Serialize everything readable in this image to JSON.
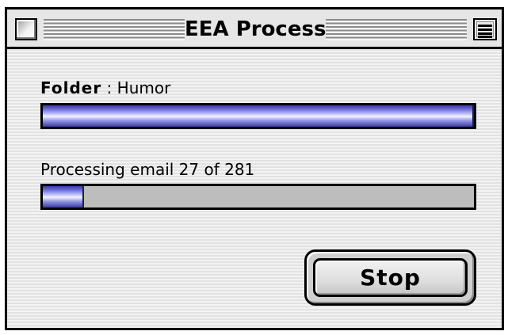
{
  "window": {
    "title": "EEA Process"
  },
  "folder": {
    "label": "Folder",
    "separator": " : ",
    "name": "Humor",
    "progress_fraction": 1.0
  },
  "status": {
    "text": "Processing email 27 of 281",
    "current": 27,
    "total": 281,
    "progress_fraction": 0.096
  },
  "actions": {
    "stop_label": "Stop"
  },
  "icons": {
    "close": "close-box-icon",
    "collapse": "collapse-box-icon"
  },
  "colors": {
    "progress_fill": "#5a5ac8",
    "progress_track": "#bdbdbd"
  }
}
